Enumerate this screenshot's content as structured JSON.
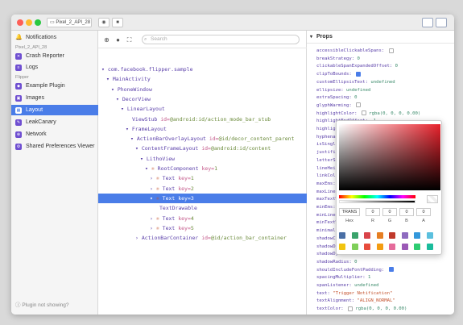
{
  "titlebar": {
    "device": "Pixel_2_API_28",
    "camera_icon": "camera-icon",
    "record_icon": "video-icon",
    "colors": {
      "close": "#fe5f57",
      "minimize": "#febc2e",
      "zoom": "#28c840"
    }
  },
  "sidebar": {
    "notifications": "Notifications",
    "device_section": "Pixel_2_API_28",
    "crash_reporter": "Crash Reporter",
    "logs": "Logs",
    "flipper_section": "Flipper",
    "example_plugin": "Example Plugin",
    "images": "Images",
    "layout": "Layout",
    "leakcanary": "LeakCanary",
    "network": "Network",
    "shared_prefs": "Shared Preferences Viewer",
    "footer": "Plugin not showing?"
  },
  "tree": {
    "search_placeholder": "Search",
    "rows": [
      {
        "name": "com.facebook.flipper.sample",
        "attr": "",
        "val": ""
      },
      {
        "name": "MainActivity",
        "attr": "",
        "val": ""
      },
      {
        "name": "PhoneWindow",
        "attr": "",
        "val": ""
      },
      {
        "name": "DecorView",
        "attr": "",
        "val": ""
      },
      {
        "name": "LinearLayout",
        "attr": "",
        "val": ""
      },
      {
        "name": "ViewStub",
        "attr": "id=",
        "val": "@android:id/action_mode_bar_stub"
      },
      {
        "name": "FrameLayout",
        "attr": "",
        "val": ""
      },
      {
        "name": "ActionBarOverlayLayout",
        "attr": "id=",
        "val": "@id/decor_content_parent"
      },
      {
        "name": "ContentFrameLayout",
        "attr": "id=",
        "val": "@android:id/content"
      },
      {
        "name": "LithoView",
        "attr": "",
        "val": ""
      },
      {
        "name": "RootComponent",
        "attr": "key=",
        "val": "1"
      },
      {
        "name": "Text",
        "attr": "key=",
        "val": "1"
      },
      {
        "name": "Text",
        "attr": "key=",
        "val": "2"
      },
      {
        "name": "Text",
        "attr": "key=",
        "val": "3"
      },
      {
        "name": "TextDrawable",
        "attr": "",
        "val": ""
      },
      {
        "name": "Text",
        "attr": "key=",
        "val": "4"
      },
      {
        "name": "Text",
        "attr": "key=",
        "val": "5"
      },
      {
        "name": "ActionBarContainer",
        "attr": "id=",
        "val": "@id/action_bar_container"
      }
    ]
  },
  "props": {
    "title": "Props",
    "items": [
      {
        "k": "accessibleClickableSpans:",
        "v": "",
        "cb": "off"
      },
      {
        "k": "breakStrategy:",
        "v": "0",
        "cb": ""
      },
      {
        "k": "clickableSpanExpandedOffset:",
        "v": "0",
        "cb": ""
      },
      {
        "k": "clipToBounds:",
        "v": "",
        "cb": "on"
      },
      {
        "k": "customEllipsisText:",
        "v": "undefined",
        "cb": ""
      },
      {
        "k": "ellipsize:",
        "v": "undefined",
        "cb": ""
      },
      {
        "k": "extraSpacing:",
        "v": "0",
        "cb": ""
      },
      {
        "k": "glyphWarming:",
        "v": "",
        "cb": "off"
      },
      {
        "k": "highlightColor:",
        "v": "rgba(0, 0, 0, 0.00)",
        "cb": "off"
      },
      {
        "k": "highlightEndOffset:",
        "v": "-1",
        "cb": ""
      },
      {
        "k": "highlightS",
        "v": "",
        "cb": ""
      },
      {
        "k": "hyphenatio",
        "v": "",
        "cb": ""
      },
      {
        "k": "isSingleLi",
        "v": "",
        "cb": ""
      },
      {
        "k": "justificat",
        "v": "",
        "cb": ""
      },
      {
        "k": "letterSpac",
        "v": "",
        "cb": ""
      },
      {
        "k": "lineHeight",
        "v": "",
        "cb": ""
      },
      {
        "k": "linkColor:",
        "v": "",
        "cb": ""
      },
      {
        "k": "maxEms:",
        "v": "-",
        "cb": ""
      },
      {
        "k": "maxLines:",
        "v": "",
        "cb": ""
      },
      {
        "k": "maxTextWid",
        "v": "",
        "cb": ""
      },
      {
        "k": "minEms:",
        "v": "-1",
        "cb": ""
      },
      {
        "k": "minLines:",
        "v": "",
        "cb": ""
      },
      {
        "k": "minTextWid",
        "v": "",
        "cb": ""
      },
      {
        "k": "minimallyW",
        "v": "",
        "cb": ""
      },
      {
        "k": "shadowColo",
        "v": "",
        "cb": ""
      },
      {
        "k": "shadowDx:",
        "v": "",
        "cb": ""
      },
      {
        "k": "shadowDy:",
        "v": "",
        "cb": ""
      },
      {
        "k": "shadowRadius:",
        "v": "0",
        "cb": ""
      },
      {
        "k": "shouldIncludeFontPadding:",
        "v": "",
        "cb": "on"
      },
      {
        "k": "spacingMultiplier:",
        "v": "1",
        "cb": ""
      },
      {
        "k": "spanListener:",
        "v": "undefined",
        "cb": ""
      },
      {
        "k": "text:",
        "v": "\"Trigger Notification\"",
        "cb": "s"
      },
      {
        "k": "textAlignment:",
        "v": "\"ALIGN_NORMAL\"",
        "cb": "s"
      },
      {
        "k": "textColor:",
        "v": "rgba(0, 0, 0, 0.00)",
        "cb": "off"
      }
    ]
  },
  "picker": {
    "hex": "TRANS",
    "r": "0",
    "g": "0",
    "b": "0",
    "a": "0",
    "labels": {
      "hex": "Hex",
      "r": "R",
      "g": "G",
      "b": "B",
      "a": "A"
    },
    "swatches": [
      "#4a6fa5",
      "#3aa36b",
      "#d9444a",
      "#e67e22",
      "#c0392b",
      "#8e6bbf",
      "#3498db",
      "#5bc0de",
      "#f1c40f",
      "#7fcf5a",
      "#e74c3c",
      "#f39c12",
      "#e56b9b",
      "#9b59b6",
      "#2ecc71",
      "#1abc9c"
    ]
  }
}
